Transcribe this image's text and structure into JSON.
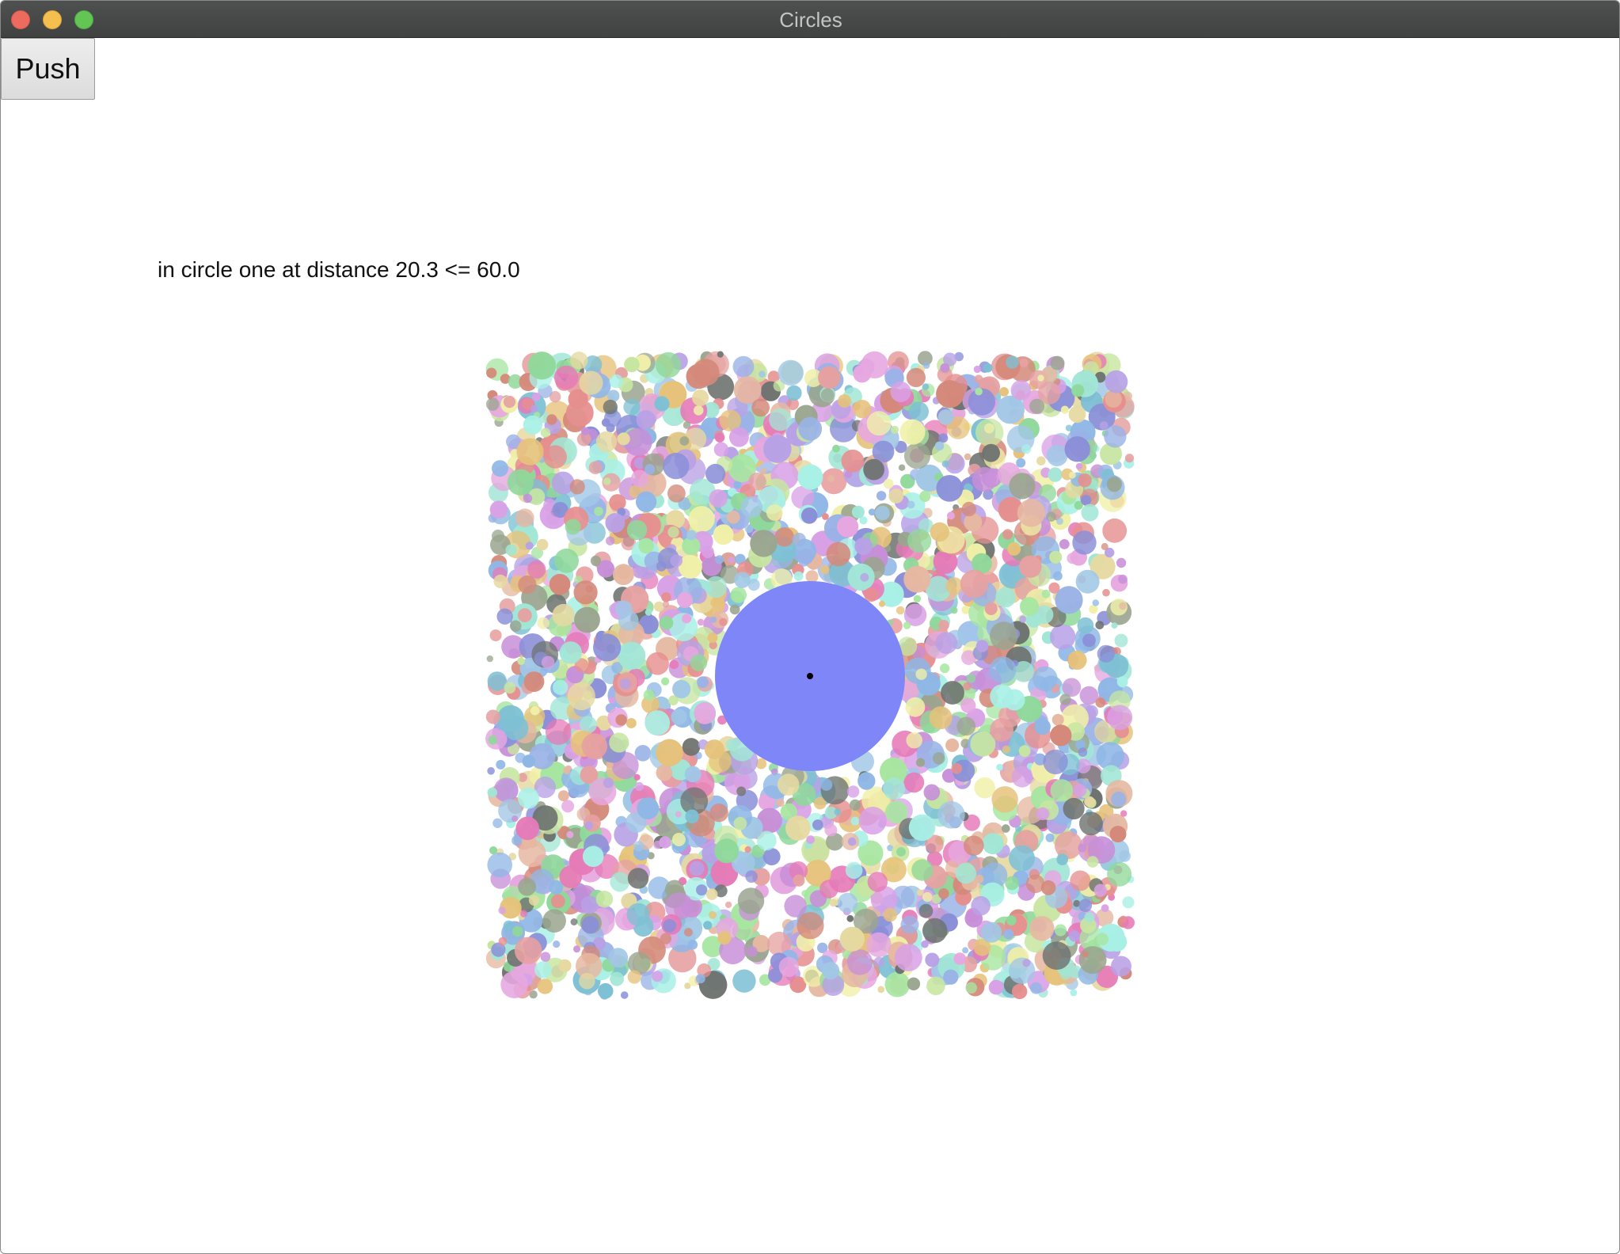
{
  "window": {
    "title": "Circles"
  },
  "controls": {
    "push_label": "Push"
  },
  "status": {
    "message": "in circle one at distance 20.3 <= 60.0",
    "distance": 20.3,
    "threshold": 60.0
  },
  "scene": {
    "highlight_color": "#7f86f8",
    "point_color": "#000000",
    "palette": [
      "#8fb7e6",
      "#a7e6a1",
      "#e6a7e0",
      "#e6d9a1",
      "#a1e6d6",
      "#e6a1a1",
      "#8a8fd8",
      "#c7e6a1",
      "#e6b8a1",
      "#a1c7e6",
      "#d8a1e6",
      "#9aa58f",
      "#7ec0d4",
      "#f0f0a8",
      "#e67ab8",
      "#8fd89a",
      "#b8a1e6",
      "#d4897a",
      "#6e7370",
      "#a8f0e6",
      "#e6c27a",
      "#9ab3e6",
      "#c78fd8",
      "#e68f8f"
    ]
  }
}
